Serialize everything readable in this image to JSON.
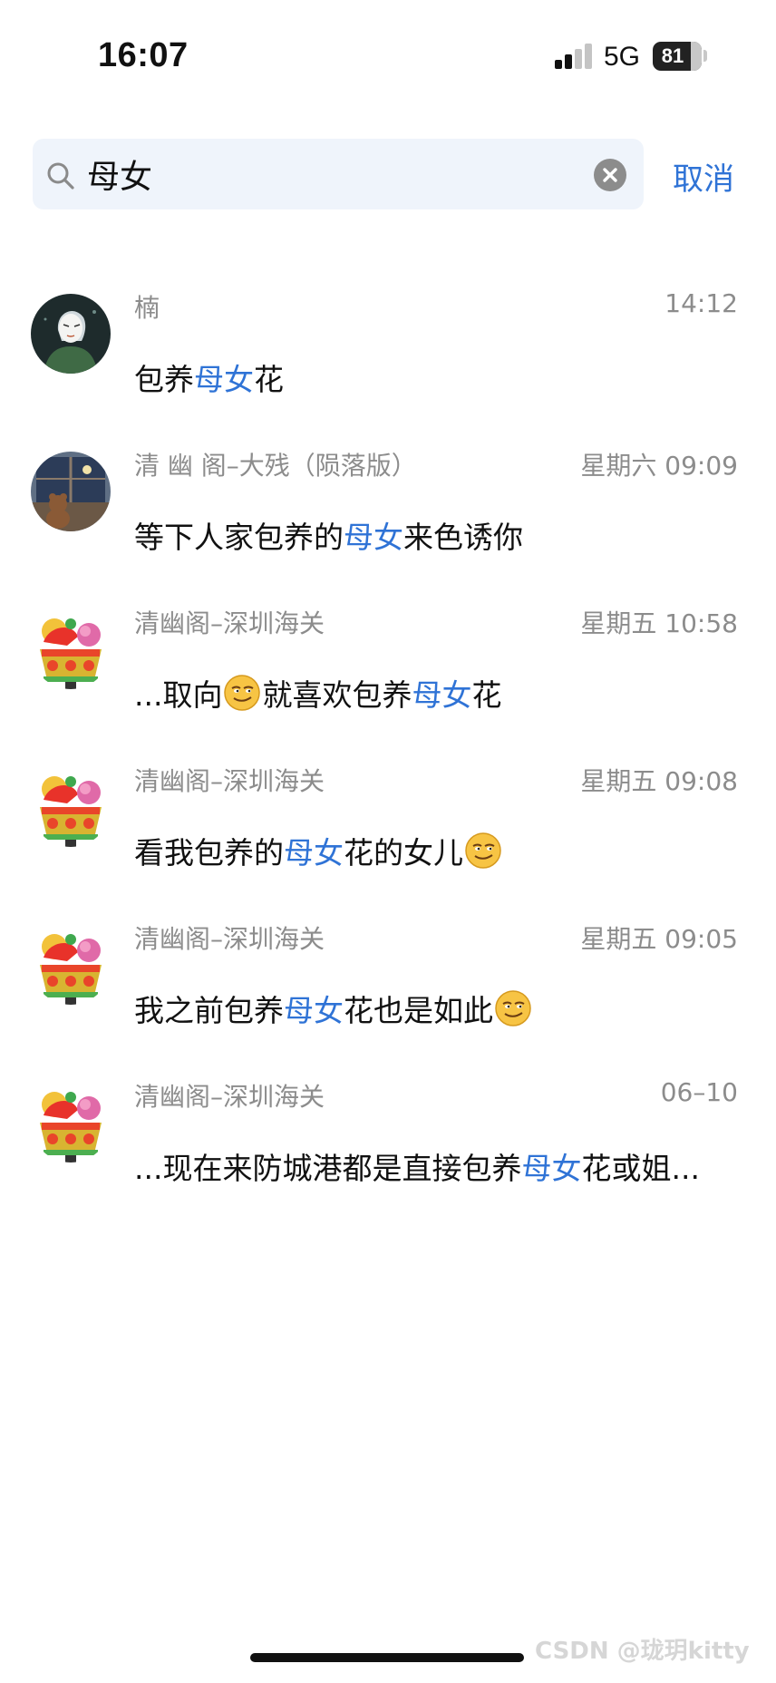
{
  "status_bar": {
    "time": "16:07",
    "network": "5G",
    "battery": "81",
    "battery_level_fraction": 0.81,
    "signal_bars_active": 2,
    "signal_bars_total": 4
  },
  "search": {
    "query": "母女",
    "cancel_label": "取消"
  },
  "colors": {
    "highlight": "#2f73d6",
    "meta_text": "#8c8c8c",
    "search_bg": "#eff4fb"
  },
  "results": [
    {
      "sender": "楠",
      "time": "14:12",
      "avatar_icon": "masked-character-avatar",
      "parts": [
        {
          "text": "包养"
        },
        {
          "text": "母女",
          "hl": true
        },
        {
          "text": "花"
        }
      ]
    },
    {
      "sender": "清 幽 阁–大残（陨落版）",
      "time": "星期六 09:09",
      "avatar_icon": "night-window-avatar",
      "parts": [
        {
          "text": "等下人家包养的"
        },
        {
          "text": "母女",
          "hl": true
        },
        {
          "text": "来色诱你"
        }
      ]
    },
    {
      "sender": "清幽阁–深圳海关",
      "time": "星期五 10:58",
      "avatar_icon": "fortune-basket-avatar",
      "parts": [
        {
          "text": "...取向"
        },
        {
          "emoji": "smirk-emoji"
        },
        {
          "text": "就喜欢包养"
        },
        {
          "text": "母女",
          "hl": true
        },
        {
          "text": "花"
        }
      ]
    },
    {
      "sender": "清幽阁–深圳海关",
      "time": "星期五 09:08",
      "avatar_icon": "fortune-basket-avatar",
      "parts": [
        {
          "text": "看我包养的"
        },
        {
          "text": "母女",
          "hl": true
        },
        {
          "text": "花的女儿"
        },
        {
          "emoji": "smirk-emoji"
        }
      ]
    },
    {
      "sender": "清幽阁–深圳海关",
      "time": "星期五 09:05",
      "avatar_icon": "fortune-basket-avatar",
      "parts": [
        {
          "text": "我之前包养"
        },
        {
          "text": "母女",
          "hl": true
        },
        {
          "text": "花也是如此"
        },
        {
          "emoji": "smirk-emoji"
        }
      ]
    },
    {
      "sender": "清幽阁–深圳海关",
      "time": "06–10",
      "avatar_icon": "fortune-basket-avatar",
      "parts": [
        {
          "text": "...现在来防城港都是直接包养"
        },
        {
          "text": "母女",
          "hl": true
        },
        {
          "text": "花或姐..."
        }
      ]
    }
  ],
  "watermark": "CSDN @珑玥kitty"
}
